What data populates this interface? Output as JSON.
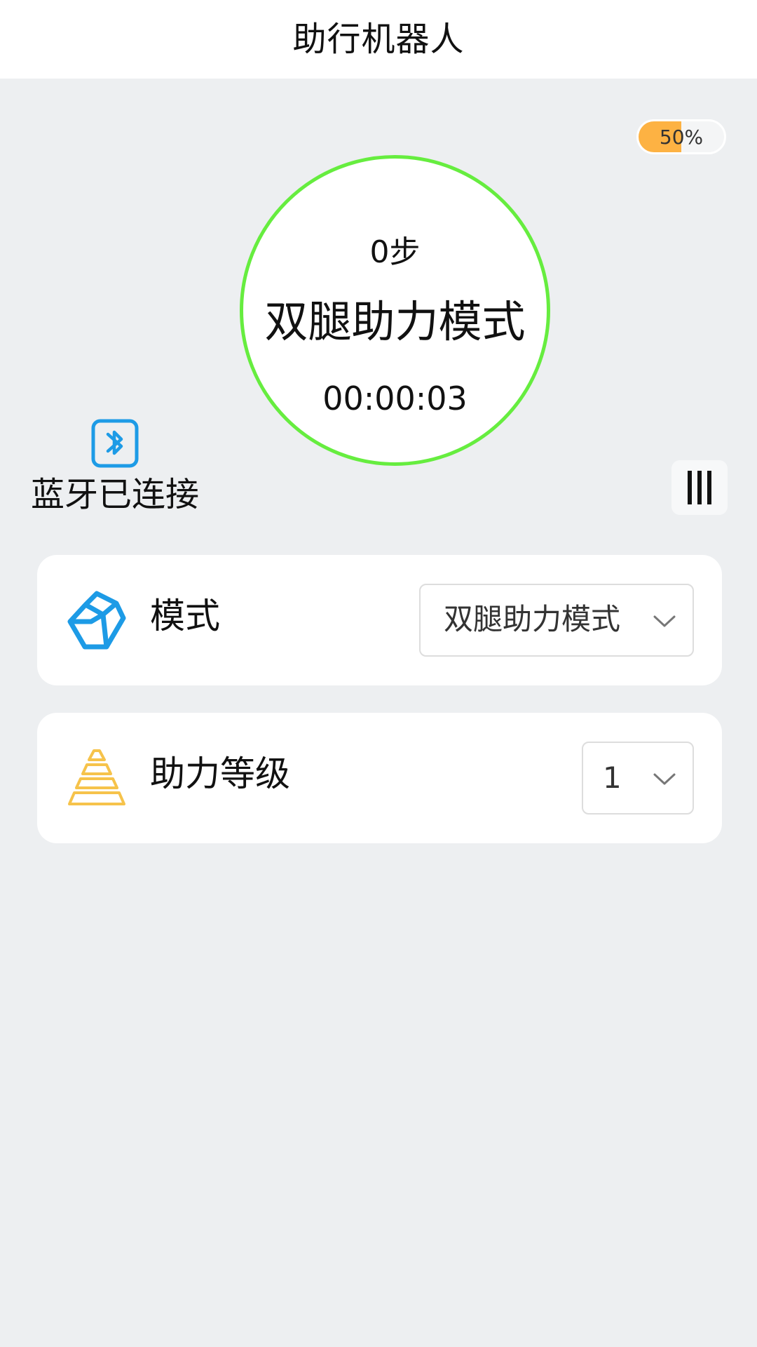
{
  "header": {
    "title": "助行机器人"
  },
  "battery": {
    "level": 50,
    "text": "50%"
  },
  "status": {
    "steps": "0步",
    "mode": "双腿助力模式",
    "timer": "00:00:03"
  },
  "bluetooth": {
    "label": "蓝牙已连接",
    "icon": "bluetooth-icon"
  },
  "menu": {
    "icon": "menu-icon"
  },
  "settings": {
    "mode": {
      "label": "模式",
      "selected": "双腿助力模式",
      "icon": "cube-icon"
    },
    "assist_level": {
      "label": "助力等级",
      "selected": "1",
      "icon": "pyramid-icon"
    }
  },
  "colors": {
    "background": "#edeff1",
    "ring": "#66ed3f",
    "battery": "#fdb243",
    "bluetooth": "#1d9be6",
    "level_icon": "#f6c34b"
  }
}
